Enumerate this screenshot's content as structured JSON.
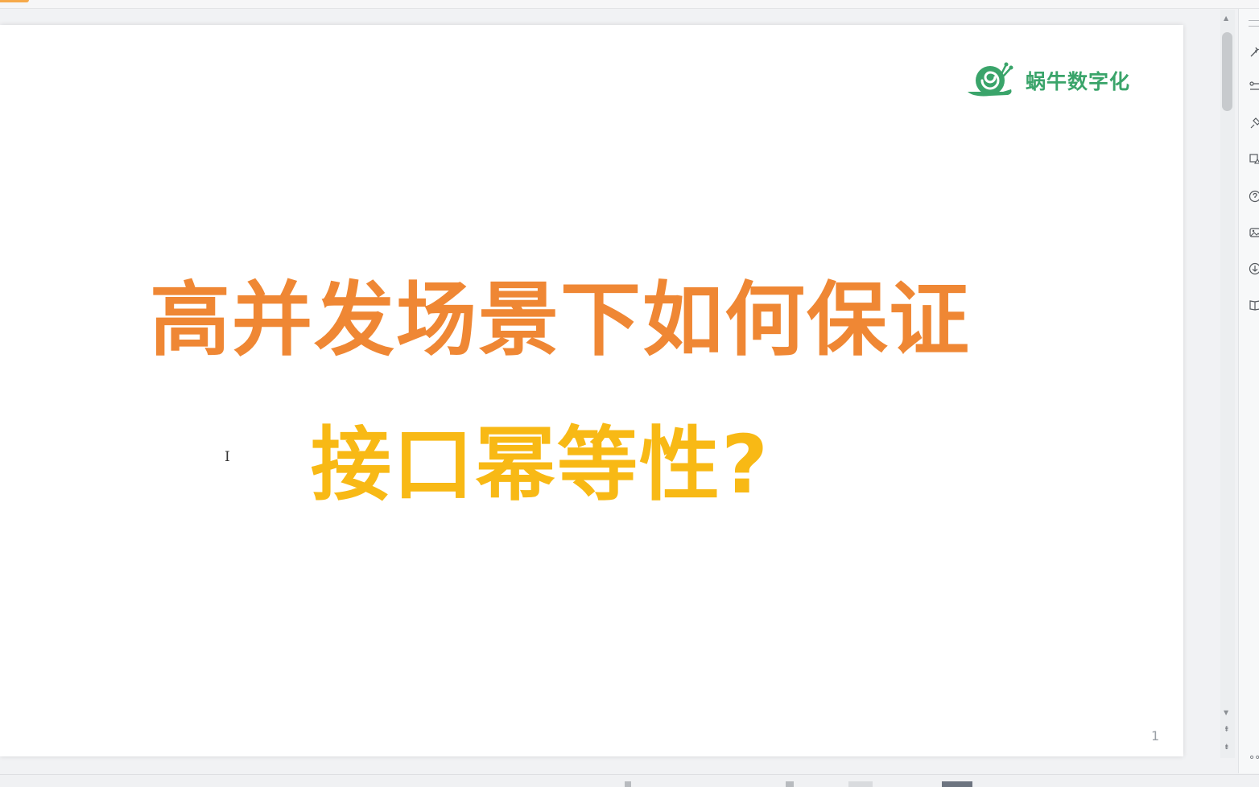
{
  "slide": {
    "logo_text": "蜗牛数字化",
    "title_line1": "高并发场景下如何保证",
    "title_line2": "接口幂等性?",
    "page_number": "1",
    "cursor_glyph": "I"
  },
  "colors": {
    "title_line1": "#ef8734",
    "title_line2": "#f8b915",
    "logo": "#3aa46a"
  },
  "right_panel": {
    "icons": [
      "magic-wand-icon",
      "settings-sliders-icon",
      "pin-icon",
      "shapes-icon",
      "help-icon",
      "image-icon",
      "download-icon",
      "book-icon"
    ],
    "more_label": "∘∘"
  },
  "scrollbar": {
    "up_arrow": "▲",
    "down_arrow": "▼",
    "prev_page": "⇞",
    "next_page": "⇟"
  }
}
